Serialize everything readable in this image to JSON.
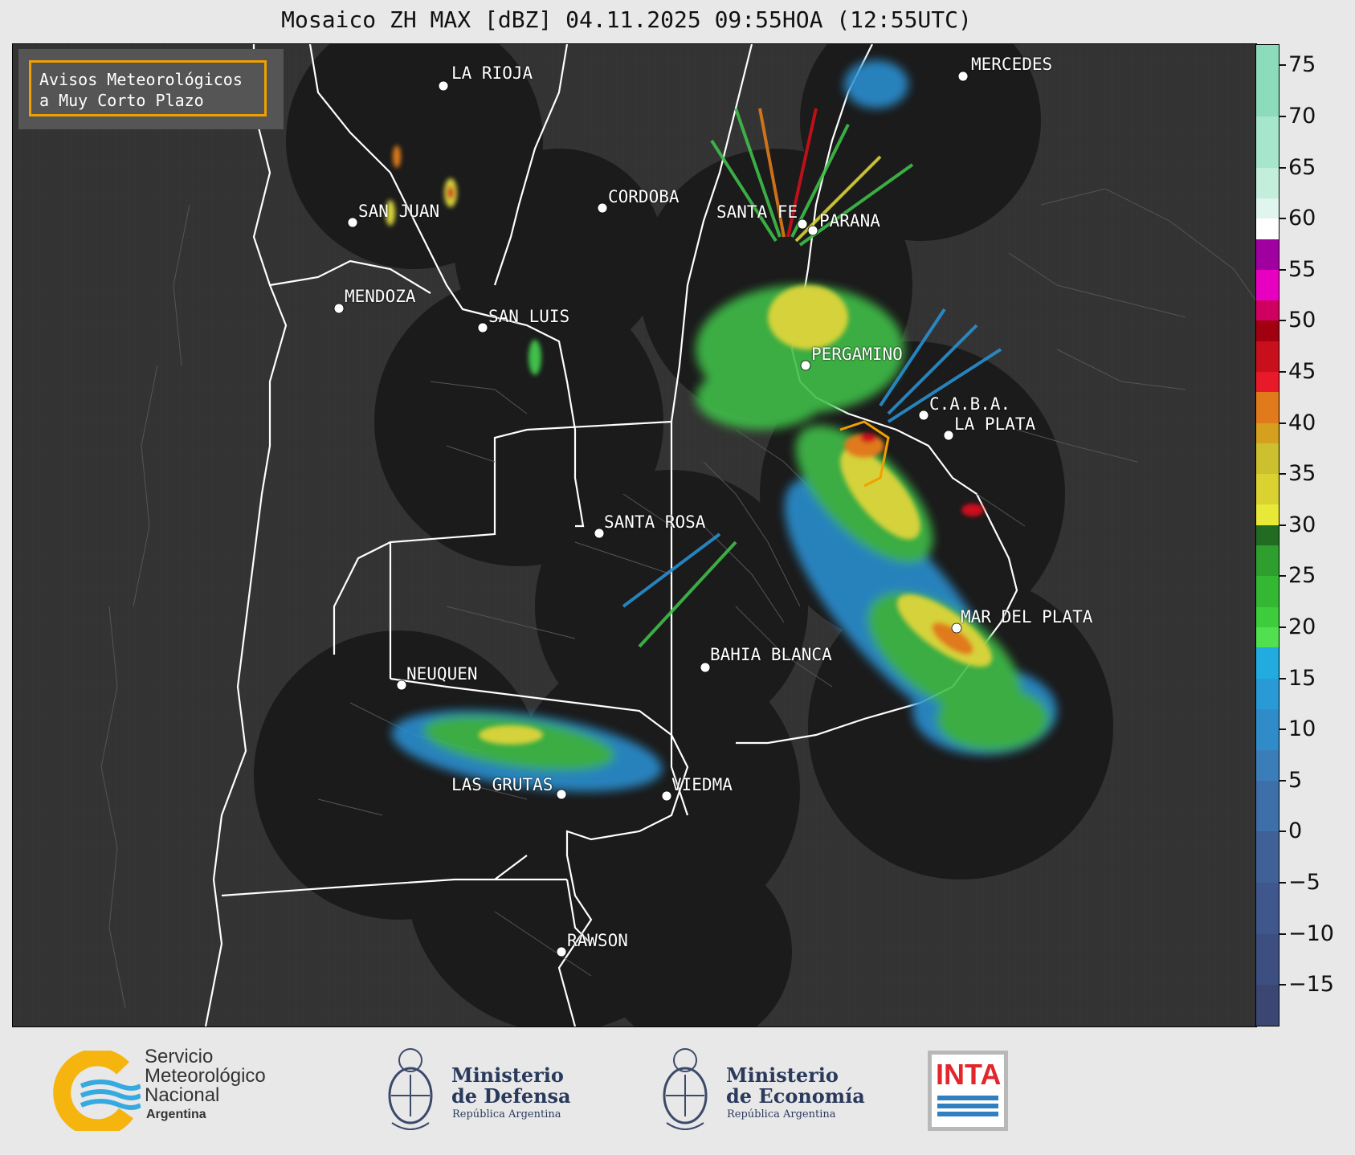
{
  "title": "Mosaico ZH MAX [dBZ] 04.11.2025 09:55HOA (12:55UTC)",
  "avisos": {
    "line1": "Avisos Meteorológicos",
    "line2": "a Muy Corto Plazo"
  },
  "cities": [
    {
      "name": "LA RIOJA"
    },
    {
      "name": "MERCEDES"
    },
    {
      "name": "CORDOBA"
    },
    {
      "name": "SAN JUAN"
    },
    {
      "name": "SANTA FE"
    },
    {
      "name": "PARANA"
    },
    {
      "name": "MENDOZA"
    },
    {
      "name": "SAN LUIS"
    },
    {
      "name": "PERGAMINO"
    },
    {
      "name": "C.A.B.A."
    },
    {
      "name": "LA PLATA"
    },
    {
      "name": "SANTA ROSA"
    },
    {
      "name": "MAR DEL PLATA"
    },
    {
      "name": "BAHIA BLANCA"
    },
    {
      "name": "NEUQUEN"
    },
    {
      "name": "LAS GRUTAS"
    },
    {
      "name": "VIEDMA"
    },
    {
      "name": "RAWSON"
    }
  ],
  "colorbar": {
    "unit": "dBZ",
    "min": -19,
    "max": 77,
    "ticks": [
      "75",
      "70",
      "65",
      "60",
      "55",
      "50",
      "45",
      "40",
      "35",
      "30",
      "25",
      "20",
      "15",
      "10",
      "5",
      "0",
      "−5",
      "−10",
      "−15"
    ],
    "tick_values": [
      75,
      70,
      65,
      60,
      55,
      50,
      45,
      40,
      35,
      30,
      25,
      20,
      15,
      10,
      5,
      0,
      -5,
      -10,
      -15
    ]
  },
  "logos": {
    "smn": {
      "line1": "Servicio",
      "line2": "Meteorológico",
      "line3": "Nacional",
      "line4": "Argentina"
    },
    "defensa": {
      "line1": "Ministerio",
      "line2": "de Defensa",
      "line3": "República Argentina"
    },
    "economia": {
      "line1": "Ministerio",
      "line2": "de Economía",
      "line3": "República Argentina"
    },
    "inta": {
      "text": "INTA"
    }
  },
  "colors": {
    "map_background": "#333333",
    "radar_coverage": "#1b1b1b",
    "border_line": "#ffffff",
    "avisos_border": "#f0a000"
  }
}
